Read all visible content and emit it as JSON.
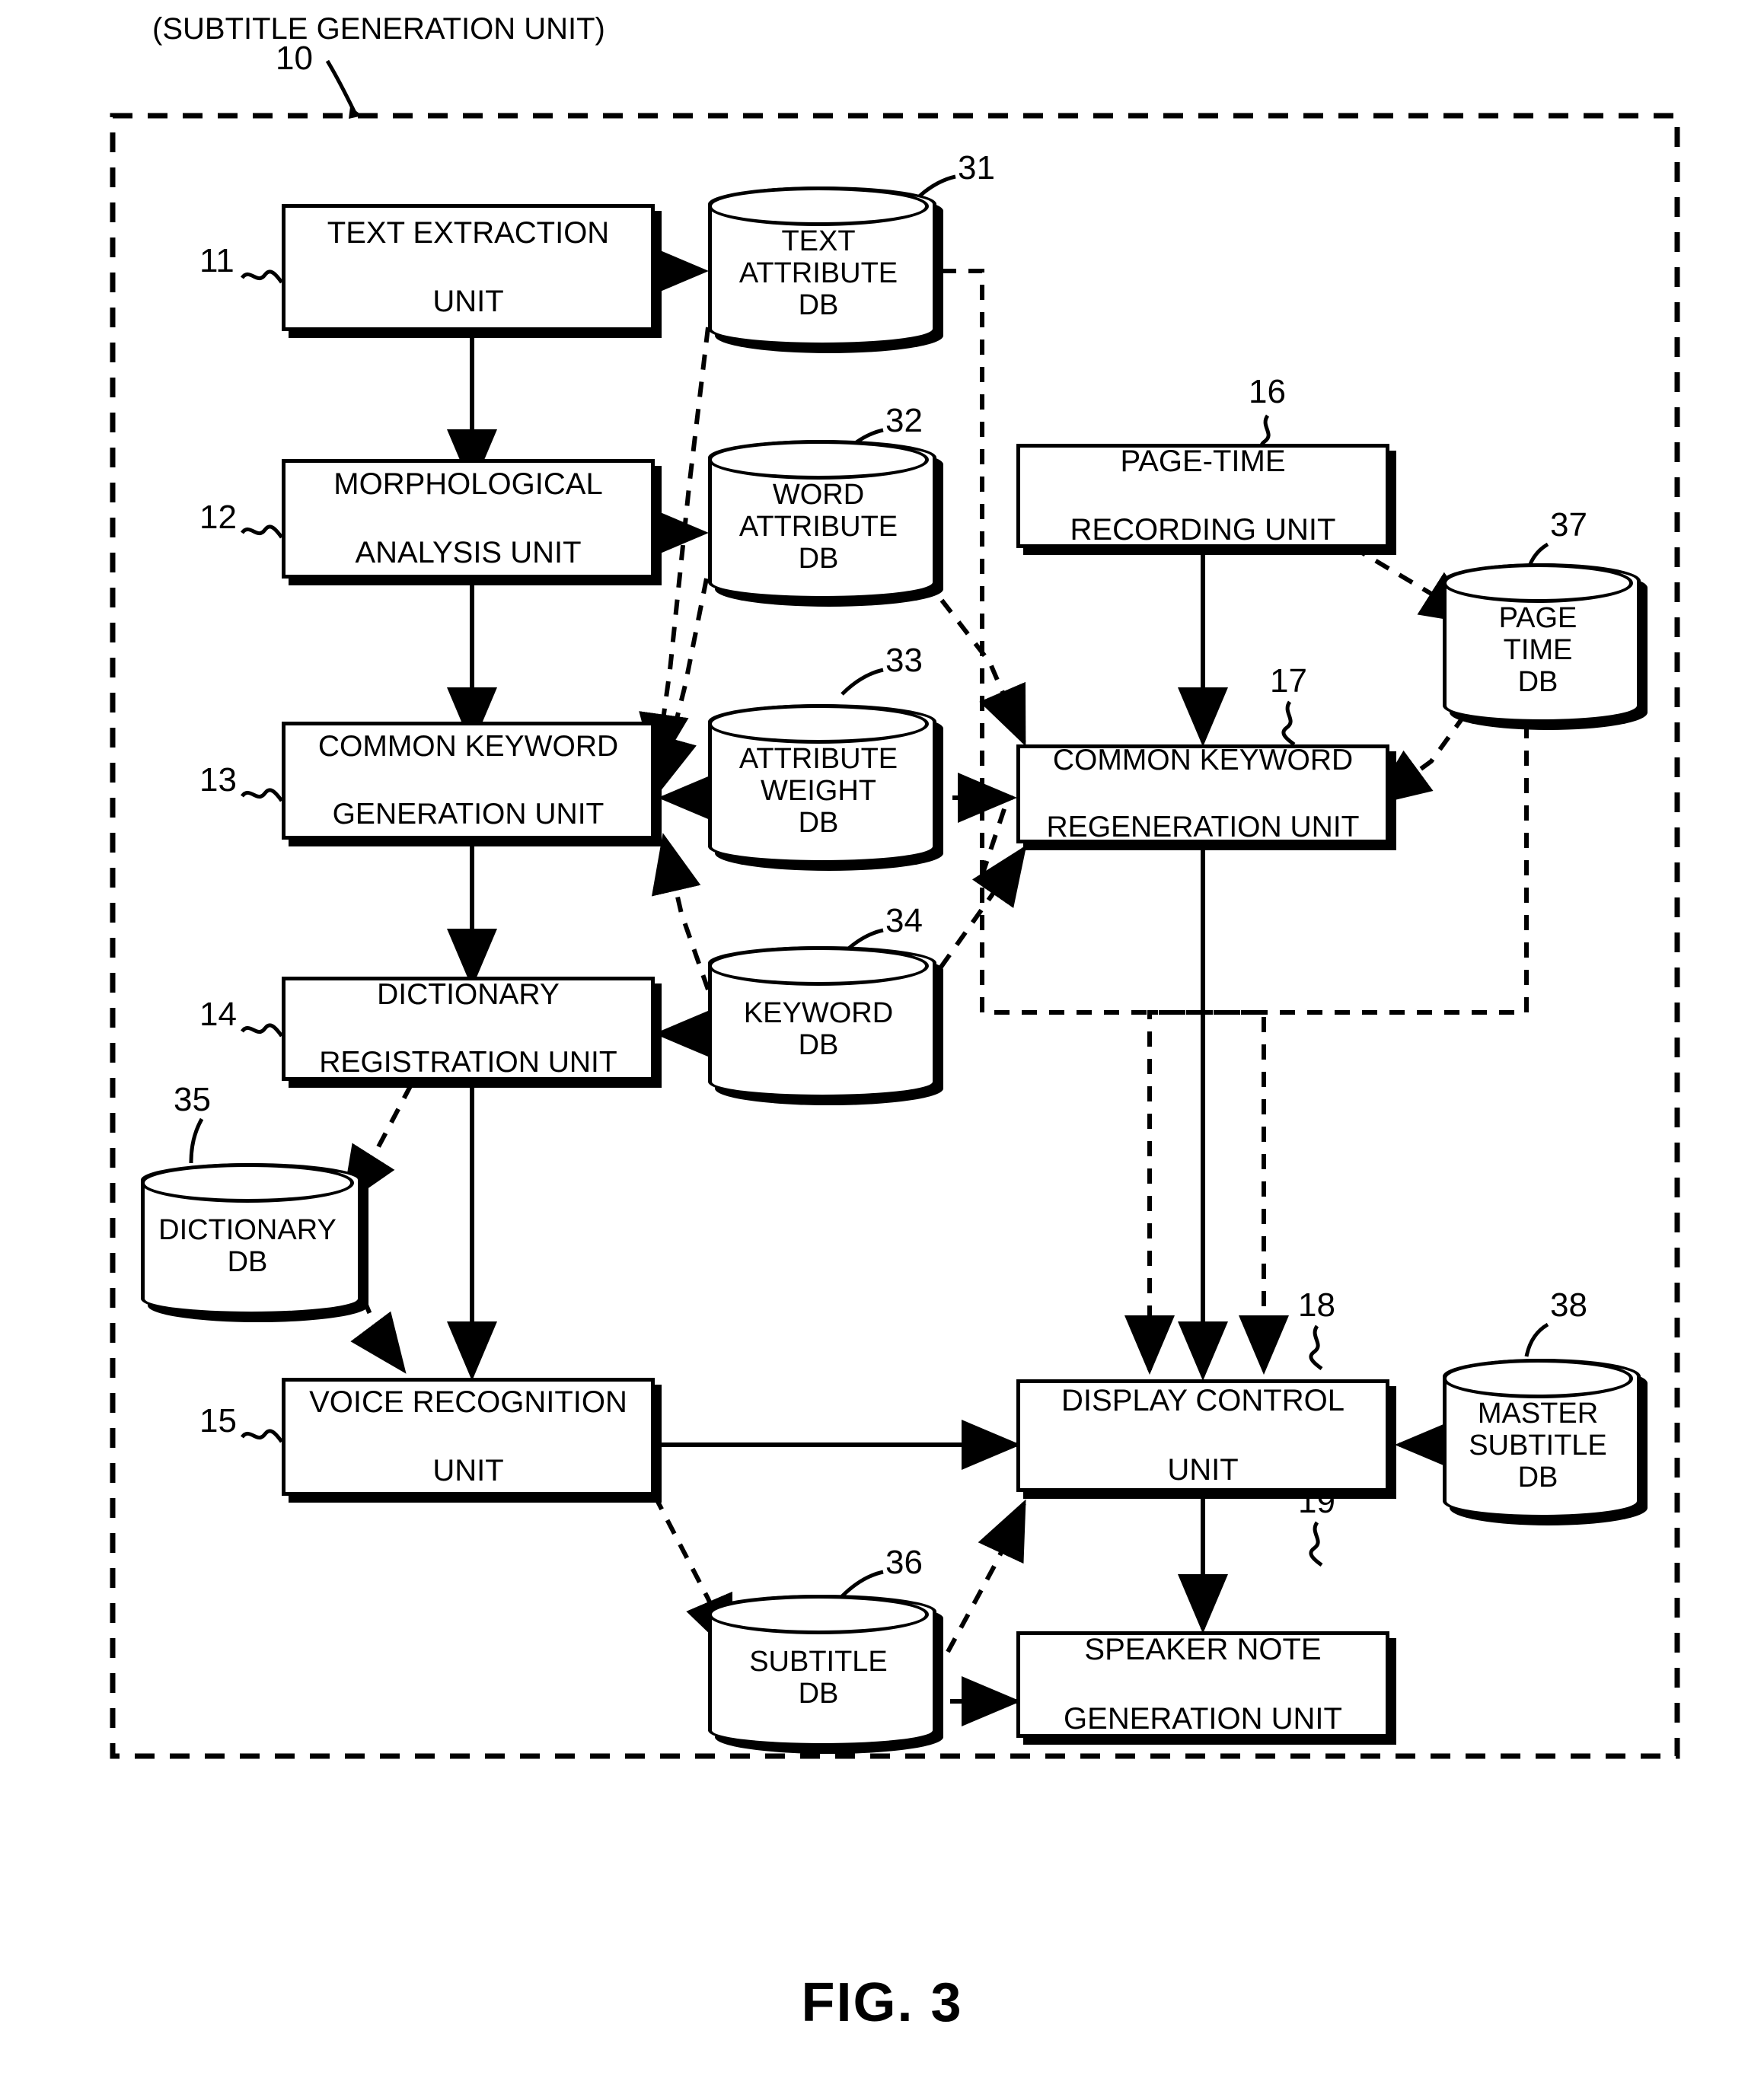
{
  "figure": {
    "caption": "FIG. 3",
    "outer_title": "(SUBTITLE GENERATION UNIT)",
    "outer_ref": "10"
  },
  "units": [
    {
      "ref": "11",
      "label": "TEXT EXTRACTION\nUNIT",
      "l1": "TEXT EXTRACTION",
      "l2": "UNIT"
    },
    {
      "ref": "12",
      "label": "MORPHOLOGICAL\nANALYSIS UNIT",
      "l1": "MORPHOLOGICAL",
      "l2": "ANALYSIS UNIT"
    },
    {
      "ref": "13",
      "label": "COMMON KEYWORD\nGENERATION UNIT",
      "l1": "COMMON KEYWORD",
      "l2": "GENERATION UNIT"
    },
    {
      "ref": "14",
      "label": "DICTIONARY\nREGISTRATION UNIT",
      "l1": "DICTIONARY",
      "l2": "REGISTRATION UNIT"
    },
    {
      "ref": "15",
      "label": "VOICE RECOGNITION\nUNIT",
      "l1": "VOICE RECOGNITION",
      "l2": "UNIT"
    },
    {
      "ref": "16",
      "label": "PAGE-TIME\nRECORDING UNIT",
      "l1": "PAGE-TIME",
      "l2": "RECORDING UNIT"
    },
    {
      "ref": "17",
      "label": "COMMON KEYWORD\nREGENERATION UNIT",
      "l1": "COMMON KEYWORD",
      "l2": "REGENERATION UNIT"
    },
    {
      "ref": "18",
      "label": "DISPLAY CONTROL\nUNIT",
      "l1": "DISPLAY CONTROL",
      "l2": "UNIT"
    },
    {
      "ref": "19",
      "label": "SPEAKER NOTE\nGENERATION UNIT",
      "l1": "SPEAKER NOTE",
      "l2": "GENERATION UNIT"
    }
  ],
  "databases": [
    {
      "ref": "31",
      "l1": "TEXT",
      "l2": "ATTRIBUTE",
      "l3": "DB"
    },
    {
      "ref": "32",
      "l1": "WORD",
      "l2": "ATTRIBUTE",
      "l3": "DB"
    },
    {
      "ref": "33",
      "l1": "ATTRIBUTE",
      "l2": "WEIGHT",
      "l3": "DB"
    },
    {
      "ref": "34",
      "l1": "KEYWORD",
      "l2": "DB",
      "l3": ""
    },
    {
      "ref": "35",
      "l1": "DICTIONARY",
      "l2": "DB",
      "l3": ""
    },
    {
      "ref": "36",
      "l1": "SUBTITLE",
      "l2": "DB",
      "l3": ""
    },
    {
      "ref": "37",
      "l1": "PAGE",
      "l2": "TIME",
      "l3": "DB"
    },
    {
      "ref": "38",
      "l1": "MASTER",
      "l2": "SUBTITLE",
      "l3": "DB"
    }
  ],
  "colors": {
    "ink": "#000000",
    "paper": "#ffffff"
  }
}
